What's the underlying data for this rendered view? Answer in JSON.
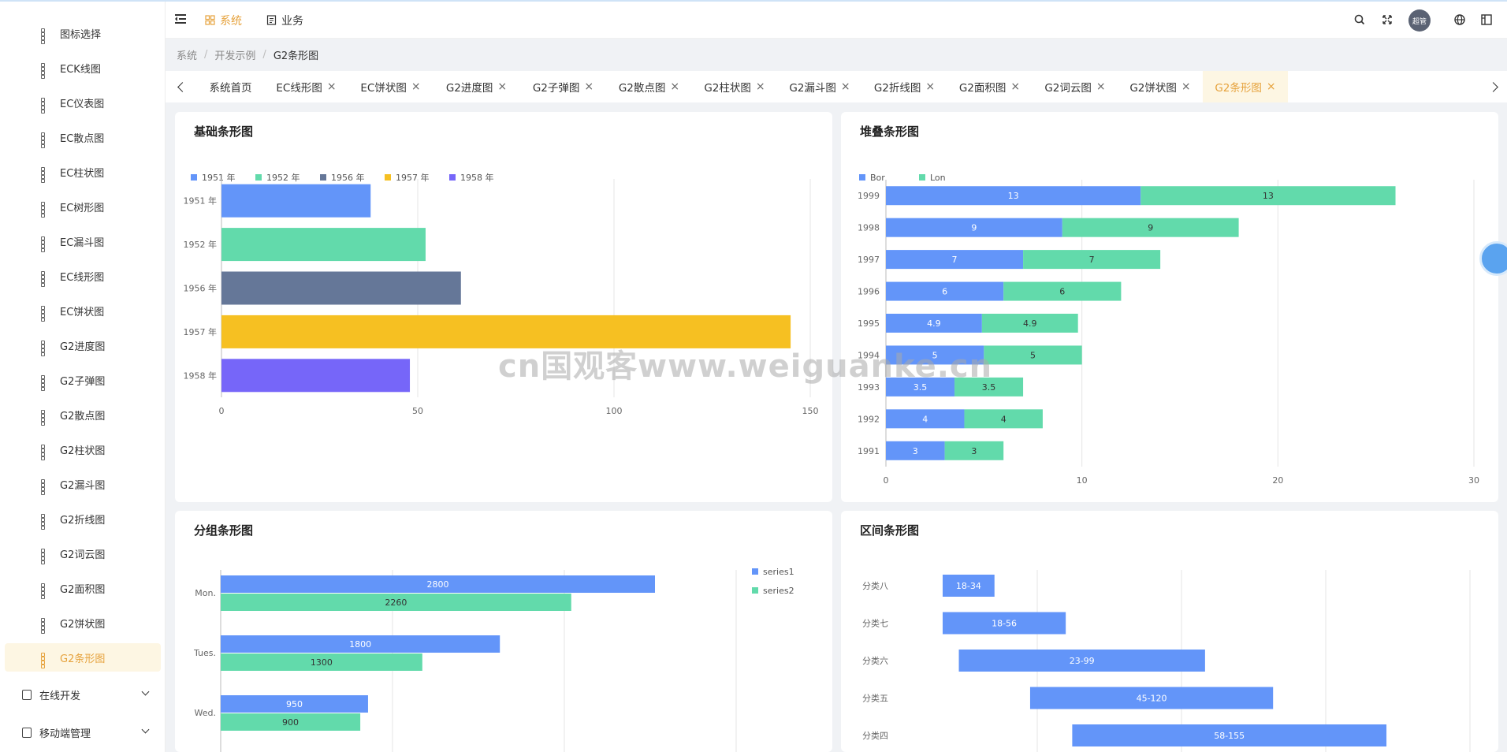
{
  "sidebar": {
    "items": [
      {
        "label": "图标选择",
        "active": false
      },
      {
        "label": "ECK线图",
        "active": false
      },
      {
        "label": "EC仪表图",
        "active": false
      },
      {
        "label": "EC散点图",
        "active": false
      },
      {
        "label": "EC柱状图",
        "active": false
      },
      {
        "label": "EC树形图",
        "active": false
      },
      {
        "label": "EC漏斗图",
        "active": false
      },
      {
        "label": "EC线形图",
        "active": false
      },
      {
        "label": "EC饼状图",
        "active": false
      },
      {
        "label": "G2进度图",
        "active": false
      },
      {
        "label": "G2子弹图",
        "active": false
      },
      {
        "label": "G2散点图",
        "active": false
      },
      {
        "label": "G2柱状图",
        "active": false
      },
      {
        "label": "G2漏斗图",
        "active": false
      },
      {
        "label": "G2折线图",
        "active": false
      },
      {
        "label": "G2词云图",
        "active": false
      },
      {
        "label": "G2面积图",
        "active": false
      },
      {
        "label": "G2饼状图",
        "active": false
      },
      {
        "label": "G2条形图",
        "active": true
      }
    ],
    "groups": [
      {
        "label": "在线开发"
      },
      {
        "label": "移动端管理"
      }
    ]
  },
  "header": {
    "nav": [
      {
        "label": "系统"
      },
      {
        "label": "业务"
      }
    ],
    "avatar": "超管",
    "icons": [
      "search-icon",
      "fullscreen-icon",
      "globe-icon",
      "layout-icon"
    ]
  },
  "breadcrumb": [
    "系统",
    "开发示例",
    "G2条形图"
  ],
  "tabs": [
    {
      "label": "系统首页",
      "closable": false,
      "active": false
    },
    {
      "label": "EC线形图",
      "closable": true,
      "active": false
    },
    {
      "label": "EC饼状图",
      "closable": true,
      "active": false
    },
    {
      "label": "G2进度图",
      "closable": true,
      "active": false
    },
    {
      "label": "G2子弹图",
      "closable": true,
      "active": false
    },
    {
      "label": "G2散点图",
      "closable": true,
      "active": false
    },
    {
      "label": "G2柱状图",
      "closable": true,
      "active": false
    },
    {
      "label": "G2漏斗图",
      "closable": true,
      "active": false
    },
    {
      "label": "G2折线图",
      "closable": true,
      "active": false
    },
    {
      "label": "G2面积图",
      "closable": true,
      "active": false
    },
    {
      "label": "G2词云图",
      "closable": true,
      "active": false
    },
    {
      "label": "G2饼状图",
      "closable": true,
      "active": false
    },
    {
      "label": "G2条形图",
      "closable": true,
      "active": true
    }
  ],
  "tab_close_glyph": "×",
  "watermark": "cn国观客www.weiguanke.cn",
  "colors": {
    "accent": "#e6a23c",
    "blue": "#6395f9",
    "green": "#62daab",
    "slate": "#657798",
    "yellow": "#f6c022",
    "purple": "#7666f9"
  },
  "chart_data": [
    {
      "type": "bar",
      "title": "基础条形图",
      "orientation": "horizontal",
      "categories": [
        "1951 年",
        "1952 年",
        "1956 年",
        "1957 年",
        "1958 年"
      ],
      "values": [
        38,
        52,
        61,
        145,
        48
      ],
      "legend": [
        "1951 年",
        "1952 年",
        "1956 年",
        "1957 年",
        "1958 年"
      ],
      "colors": [
        "#6395f9",
        "#62daab",
        "#657798",
        "#f6c022",
        "#7666f9"
      ],
      "xlim": [
        0,
        150
      ],
      "xticks": [
        0,
        50,
        100,
        150
      ],
      "legend_position": "top-left",
      "grid": true
    },
    {
      "type": "bar",
      "title": "堆叠条形图",
      "orientation": "horizontal",
      "stacked": true,
      "categories": [
        "1999",
        "1998",
        "1997",
        "1996",
        "1995",
        "1994",
        "1993",
        "1992",
        "1991"
      ],
      "series": [
        {
          "name": "Bor",
          "values": [
            13,
            9,
            7,
            6,
            4.9,
            5,
            3.5,
            4,
            3
          ]
        },
        {
          "name": "Lon",
          "values": [
            13,
            9,
            7,
            6,
            4.9,
            5,
            3.5,
            4,
            3
          ]
        }
      ],
      "colors": [
        "#6395f9",
        "#62daab"
      ],
      "xlim": [
        0,
        30
      ],
      "xticks": [
        0,
        10,
        20,
        30
      ],
      "legend_position": "top-left",
      "grid": true,
      "data_labels": true
    },
    {
      "type": "bar",
      "title": "分组条形图",
      "orientation": "horizontal",
      "grouped": true,
      "categories": [
        "Mon.",
        "Tues.",
        "Wed."
      ],
      "series": [
        {
          "name": "series1",
          "values": [
            2800,
            1800,
            950
          ]
        },
        {
          "name": "series2",
          "values": [
            2260,
            1300,
            900
          ]
        }
      ],
      "colors": [
        "#6395f9",
        "#62daab"
      ],
      "xlim": [
        0,
        3000
      ],
      "legend_position": "top-right",
      "grid": true,
      "data_labels": true
    },
    {
      "type": "bar",
      "title": "区间条形图",
      "orientation": "horizontal",
      "range": true,
      "categories": [
        "分类八",
        "分类七",
        "分类六",
        "分类五",
        "分类四"
      ],
      "ranges": [
        [
          18,
          34
        ],
        [
          18,
          56
        ],
        [
          23,
          99
        ],
        [
          45,
          120
        ],
        [
          58,
          155
        ]
      ],
      "labels": [
        "18-34",
        "18-56",
        "23-99",
        "45-120",
        "58-155"
      ],
      "colors": [
        "#6395f9"
      ],
      "xlim": [
        0,
        160
      ],
      "grid": true,
      "data_labels": true
    }
  ]
}
